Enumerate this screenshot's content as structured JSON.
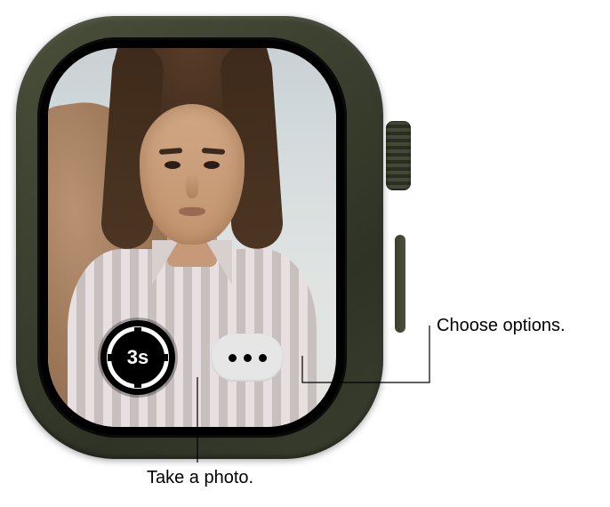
{
  "viewfinder": {
    "description": "Camera remote viewfinder showing a woman outdoors"
  },
  "controls": {
    "shutter": {
      "timer_label": "3s"
    },
    "more": {
      "icon": "ellipsis"
    }
  },
  "callouts": {
    "options": "Choose options.",
    "shutter": "Take a photo."
  }
}
